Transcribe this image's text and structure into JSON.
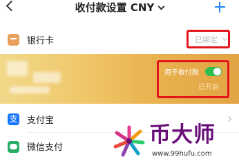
{
  "header": {
    "title": "收付款设置 CNY",
    "back_icon": "chevron-left-icon",
    "add_icon": "plus-icon",
    "accent_color": "#1f86ff"
  },
  "bank_card": {
    "label": "银行卡",
    "status": "已绑定",
    "icon": "bank-card-icon"
  },
  "card_panel": {
    "use_for_receipt_label": "用于收付款",
    "toggle_on": true,
    "enabled_status": "已开启"
  },
  "alipay": {
    "label": "支付宝",
    "icon_glyph": "支",
    "icon": "alipay-icon"
  },
  "wechat": {
    "label": "微信支付",
    "icon": "wechat-pay-icon"
  },
  "watermark": {
    "brand": "币大师",
    "url": "www.99hufu.com"
  },
  "colors": {
    "highlight_red": "#e3151b",
    "toggle_green": "#2fbf4f",
    "card_gold": "#e9b24f",
    "brand_purple": "#6a0f7a"
  }
}
